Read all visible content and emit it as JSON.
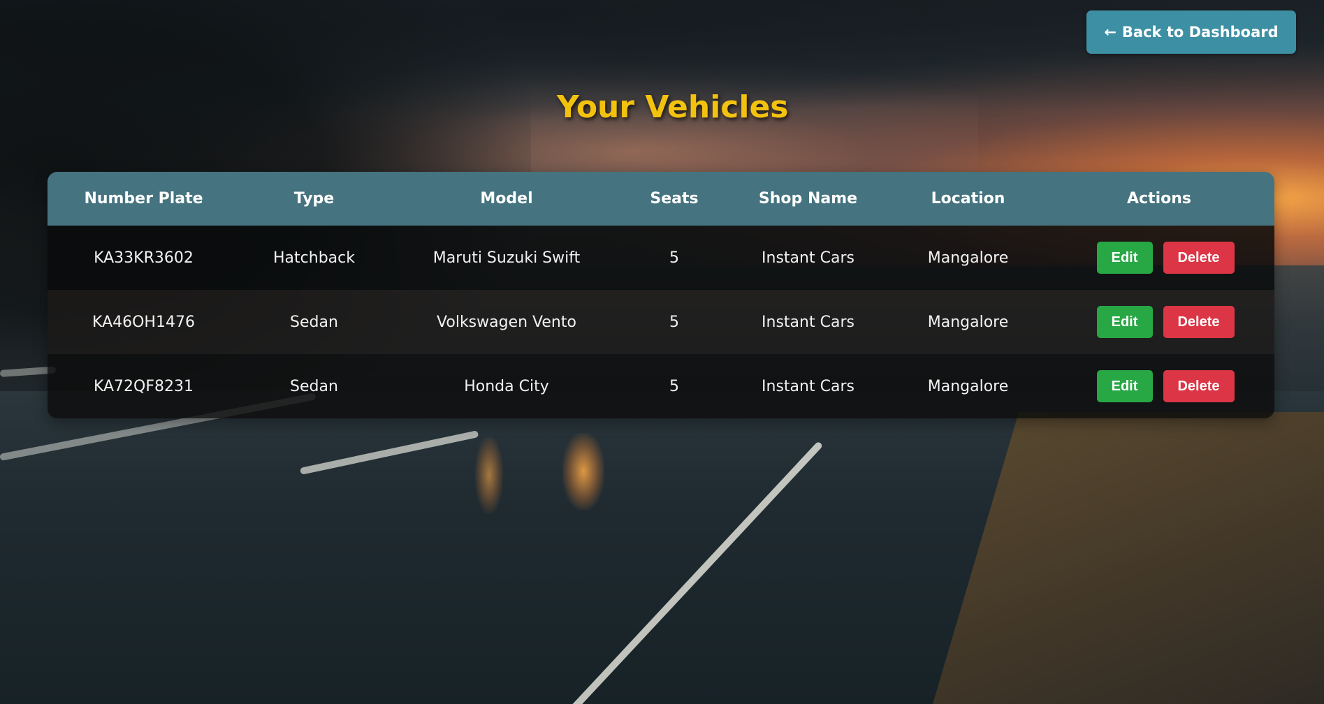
{
  "header": {
    "back_label": "Back to Dashboard",
    "back_arrow": "←"
  },
  "page": {
    "title": "Your Vehicles"
  },
  "table": {
    "columns": [
      "Number Plate",
      "Type",
      "Model",
      "Seats",
      "Shop Name",
      "Location",
      "Actions"
    ],
    "rows": [
      {
        "plate": "KA33KR3602",
        "type": "Hatchback",
        "model": "Maruti Suzuki Swift",
        "seats": "5",
        "shop": "Instant Cars",
        "location": "Mangalore"
      },
      {
        "plate": "KA46OH1476",
        "type": "Sedan",
        "model": "Volkswagen Vento",
        "seats": "5",
        "shop": "Instant Cars",
        "location": "Mangalore"
      },
      {
        "plate": "KA72QF8231",
        "type": "Sedan",
        "model": "Honda City",
        "seats": "5",
        "shop": "Instant Cars",
        "location": "Mangalore"
      }
    ],
    "edit_label": "Edit",
    "delete_label": "Delete"
  },
  "colors": {
    "accent_button": "#3d8fa3",
    "title": "#f3c20f",
    "table_header": "#45737f",
    "edit": "#28a745",
    "delete": "#dc3545"
  }
}
